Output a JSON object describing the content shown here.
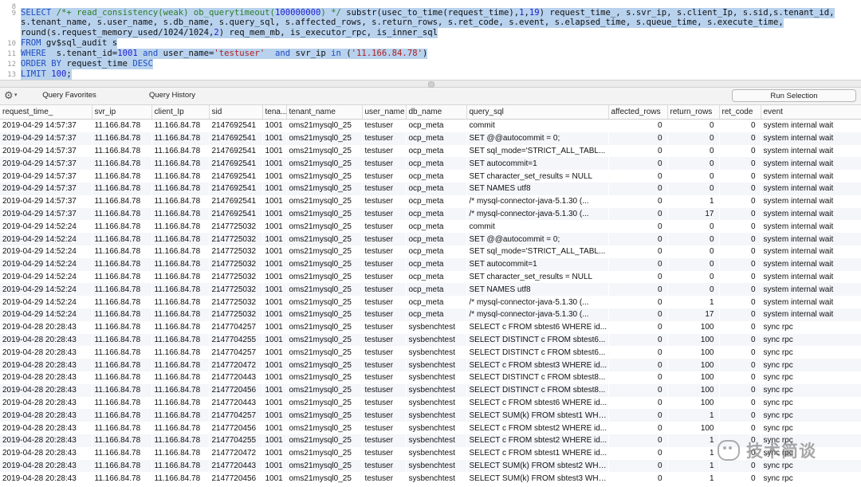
{
  "editor": {
    "lines": [
      {
        "num": "8",
        "text": "",
        "selected": false
      },
      {
        "num": "9",
        "text": "SELECT /*+ read_consistency(weak) ob_querytimeout(100000000) */ substr(usec_to_time(request_time),1,19) request_time_, s.svr_ip, s.client_Ip, s.sid,s.tenant_id,",
        "selected": true
      },
      {
        "num": "",
        "text": "s.tenant_name, s.user_name, s.db_name, s.query_sql, s.affected_rows, s.return_rows, s.ret_code, s.event, s.elapsed_time, s.queue_time, s.execute_time,",
        "selected": true
      },
      {
        "num": "",
        "text": "round(s.request_memory_used/1024/1024,2) req_mem_mb, is_executor_rpc, is_inner_sql",
        "selected": true
      },
      {
        "num": "10",
        "text": "FROM gv$sql_audit s",
        "selected": true
      },
      {
        "num": "11",
        "text": "WHERE  s.tenant_id=1001 and user_name='testuser'  and svr_ip in ('11.166.84.78')",
        "selected": true
      },
      {
        "num": "12",
        "text": "ORDER BY request_time DESC",
        "selected": true
      },
      {
        "num": "13",
        "text": "LIMIT 100;",
        "selected": true
      }
    ]
  },
  "toolbar": {
    "query_favorites": "Query Favorites",
    "query_history": "Query History",
    "run_selection": "Run Selection"
  },
  "grid": {
    "columns": [
      "request_time_",
      "svr_ip",
      "client_Ip",
      "sid",
      "tena...",
      "tenant_name",
      "user_name",
      "db_name",
      "query_sql",
      "affected_rows",
      "return_rows",
      "ret_code",
      "event"
    ],
    "rows": [
      [
        "2019-04-29 14:57:37",
        "11.166.84.78",
        "11.166.84.78",
        "2147692541",
        "1001",
        "oms21mysql0_25",
        "testuser",
        "ocp_meta",
        "commit",
        "0",
        "0",
        "0",
        "system internal wait"
      ],
      [
        "2019-04-29 14:57:37",
        "11.166.84.78",
        "11.166.84.78",
        "2147692541",
        "1001",
        "oms21mysql0_25",
        "testuser",
        "ocp_meta",
        "SET @@autocommit = 0;",
        "0",
        "0",
        "0",
        "system internal wait"
      ],
      [
        "2019-04-29 14:57:37",
        "11.166.84.78",
        "11.166.84.78",
        "2147692541",
        "1001",
        "oms21mysql0_25",
        "testuser",
        "ocp_meta",
        "SET sql_mode='STRICT_ALL_TABL...",
        "0",
        "0",
        "0",
        "system internal wait"
      ],
      [
        "2019-04-29 14:57:37",
        "11.166.84.78",
        "11.166.84.78",
        "2147692541",
        "1001",
        "oms21mysql0_25",
        "testuser",
        "ocp_meta",
        "SET autocommit=1",
        "0",
        "0",
        "0",
        "system internal wait"
      ],
      [
        "2019-04-29 14:57:37",
        "11.166.84.78",
        "11.166.84.78",
        "2147692541",
        "1001",
        "oms21mysql0_25",
        "testuser",
        "ocp_meta",
        "SET character_set_results = NULL",
        "0",
        "0",
        "0",
        "system internal wait"
      ],
      [
        "2019-04-29 14:57:37",
        "11.166.84.78",
        "11.166.84.78",
        "2147692541",
        "1001",
        "oms21mysql0_25",
        "testuser",
        "ocp_meta",
        "SET NAMES utf8",
        "0",
        "0",
        "0",
        "system internal wait"
      ],
      [
        "2019-04-29 14:57:37",
        "11.166.84.78",
        "11.166.84.78",
        "2147692541",
        "1001",
        "oms21mysql0_25",
        "testuser",
        "ocp_meta",
        "/* mysql-connector-java-5.1.30 (...",
        "0",
        "1",
        "0",
        "system internal wait"
      ],
      [
        "2019-04-29 14:57:37",
        "11.166.84.78",
        "11.166.84.78",
        "2147692541",
        "1001",
        "oms21mysql0_25",
        "testuser",
        "ocp_meta",
        "/* mysql-connector-java-5.1.30 (...",
        "0",
        "17",
        "0",
        "system internal wait"
      ],
      [
        "2019-04-29 14:52:24",
        "11.166.84.78",
        "11.166.84.78",
        "2147725032",
        "1001",
        "oms21mysql0_25",
        "testuser",
        "ocp_meta",
        "commit",
        "0",
        "0",
        "0",
        "system internal wait"
      ],
      [
        "2019-04-29 14:52:24",
        "11.166.84.78",
        "11.166.84.78",
        "2147725032",
        "1001",
        "oms21mysql0_25",
        "testuser",
        "ocp_meta",
        "SET @@autocommit = 0;",
        "0",
        "0",
        "0",
        "system internal wait"
      ],
      [
        "2019-04-29 14:52:24",
        "11.166.84.78",
        "11.166.84.78",
        "2147725032",
        "1001",
        "oms21mysql0_25",
        "testuser",
        "ocp_meta",
        "SET sql_mode='STRICT_ALL_TABL...",
        "0",
        "0",
        "0",
        "system internal wait"
      ],
      [
        "2019-04-29 14:52:24",
        "11.166.84.78",
        "11.166.84.78",
        "2147725032",
        "1001",
        "oms21mysql0_25",
        "testuser",
        "ocp_meta",
        "SET autocommit=1",
        "0",
        "0",
        "0",
        "system internal wait"
      ],
      [
        "2019-04-29 14:52:24",
        "11.166.84.78",
        "11.166.84.78",
        "2147725032",
        "1001",
        "oms21mysql0_25",
        "testuser",
        "ocp_meta",
        "SET character_set_results = NULL",
        "0",
        "0",
        "0",
        "system internal wait"
      ],
      [
        "2019-04-29 14:52:24",
        "11.166.84.78",
        "11.166.84.78",
        "2147725032",
        "1001",
        "oms21mysql0_25",
        "testuser",
        "ocp_meta",
        "SET NAMES utf8",
        "0",
        "0",
        "0",
        "system internal wait"
      ],
      [
        "2019-04-29 14:52:24",
        "11.166.84.78",
        "11.166.84.78",
        "2147725032",
        "1001",
        "oms21mysql0_25",
        "testuser",
        "ocp_meta",
        "/* mysql-connector-java-5.1.30 (...",
        "0",
        "1",
        "0",
        "system internal wait"
      ],
      [
        "2019-04-29 14:52:24",
        "11.166.84.78",
        "11.166.84.78",
        "2147725032",
        "1001",
        "oms21mysql0_25",
        "testuser",
        "ocp_meta",
        "/* mysql-connector-java-5.1.30 (...",
        "0",
        "17",
        "0",
        "system internal wait"
      ],
      [
        "2019-04-28 20:28:43",
        "11.166.84.78",
        "11.166.84.78",
        "2147704257",
        "1001",
        "oms21mysql0_25",
        "testuser",
        "sysbenchtest",
        "SELECT c FROM sbtest6 WHERE id...",
        "0",
        "100",
        "0",
        "sync rpc"
      ],
      [
        "2019-04-28 20:28:43",
        "11.166.84.78",
        "11.166.84.78",
        "2147704255",
        "1001",
        "oms21mysql0_25",
        "testuser",
        "sysbenchtest",
        "SELECT DISTINCT c FROM sbtest6...",
        "0",
        "100",
        "0",
        "sync rpc"
      ],
      [
        "2019-04-28 20:28:43",
        "11.166.84.78",
        "11.166.84.78",
        "2147704257",
        "1001",
        "oms21mysql0_25",
        "testuser",
        "sysbenchtest",
        "SELECT DISTINCT c FROM sbtest6...",
        "0",
        "100",
        "0",
        "sync rpc"
      ],
      [
        "2019-04-28 20:28:43",
        "11.166.84.78",
        "11.166.84.78",
        "2147720472",
        "1001",
        "oms21mysql0_25",
        "testuser",
        "sysbenchtest",
        "SELECT c FROM sbtest3 WHERE id...",
        "0",
        "100",
        "0",
        "sync rpc"
      ],
      [
        "2019-04-28 20:28:43",
        "11.166.84.78",
        "11.166.84.78",
        "2147720443",
        "1001",
        "oms21mysql0_25",
        "testuser",
        "sysbenchtest",
        "SELECT DISTINCT c FROM sbtest8...",
        "0",
        "100",
        "0",
        "sync rpc"
      ],
      [
        "2019-04-28 20:28:43",
        "11.166.84.78",
        "11.166.84.78",
        "2147720456",
        "1001",
        "oms21mysql0_25",
        "testuser",
        "sysbenchtest",
        "SELECT DISTINCT c FROM sbtest8...",
        "0",
        "100",
        "0",
        "sync rpc"
      ],
      [
        "2019-04-28 20:28:43",
        "11.166.84.78",
        "11.166.84.78",
        "2147720443",
        "1001",
        "oms21mysql0_25",
        "testuser",
        "sysbenchtest",
        "SELECT c FROM sbtest6 WHERE id...",
        "0",
        "100",
        "0",
        "sync rpc"
      ],
      [
        "2019-04-28 20:28:43",
        "11.166.84.78",
        "11.166.84.78",
        "2147704257",
        "1001",
        "oms21mysql0_25",
        "testuser",
        "sysbenchtest",
        "SELECT SUM(k) FROM sbtest1 WHE...",
        "0",
        "1",
        "0",
        "sync rpc"
      ],
      [
        "2019-04-28 20:28:43",
        "11.166.84.78",
        "11.166.84.78",
        "2147720456",
        "1001",
        "oms21mysql0_25",
        "testuser",
        "sysbenchtest",
        "SELECT c FROM sbtest2 WHERE id...",
        "0",
        "100",
        "0",
        "sync rpc"
      ],
      [
        "2019-04-28 20:28:43",
        "11.166.84.78",
        "11.166.84.78",
        "2147704255",
        "1001",
        "oms21mysql0_25",
        "testuser",
        "sysbenchtest",
        "SELECT c FROM sbtest2 WHERE id...",
        "0",
        "1",
        "0",
        "sync rpc"
      ],
      [
        "2019-04-28 20:28:43",
        "11.166.84.78",
        "11.166.84.78",
        "2147720472",
        "1001",
        "oms21mysql0_25",
        "testuser",
        "sysbenchtest",
        "SELECT c FROM sbtest1 WHERE id...",
        "0",
        "1",
        "0",
        "sync rpc"
      ],
      [
        "2019-04-28 20:28:43",
        "11.166.84.78",
        "11.166.84.78",
        "2147720443",
        "1001",
        "oms21mysql0_25",
        "testuser",
        "sysbenchtest",
        "SELECT SUM(k) FROM sbtest2 WHE...",
        "0",
        "1",
        "0",
        "sync rpc"
      ],
      [
        "2019-04-28 20:28:43",
        "11.166.84.78",
        "11.166.84.78",
        "2147720456",
        "1001",
        "oms21mysql0_25",
        "testuser",
        "sysbenchtest",
        "SELECT SUM(k) FROM sbtest3 WHE...",
        "0",
        "1",
        "0",
        "sync rpc"
      ]
    ]
  },
  "watermark": {
    "text": "技术简谈",
    "icon": "wechat-icon"
  },
  "colors": {
    "selection": "#b8d2ee",
    "keyword": "#1f4dbf",
    "comment": "#2a7d2a",
    "string": "#b02020"
  }
}
